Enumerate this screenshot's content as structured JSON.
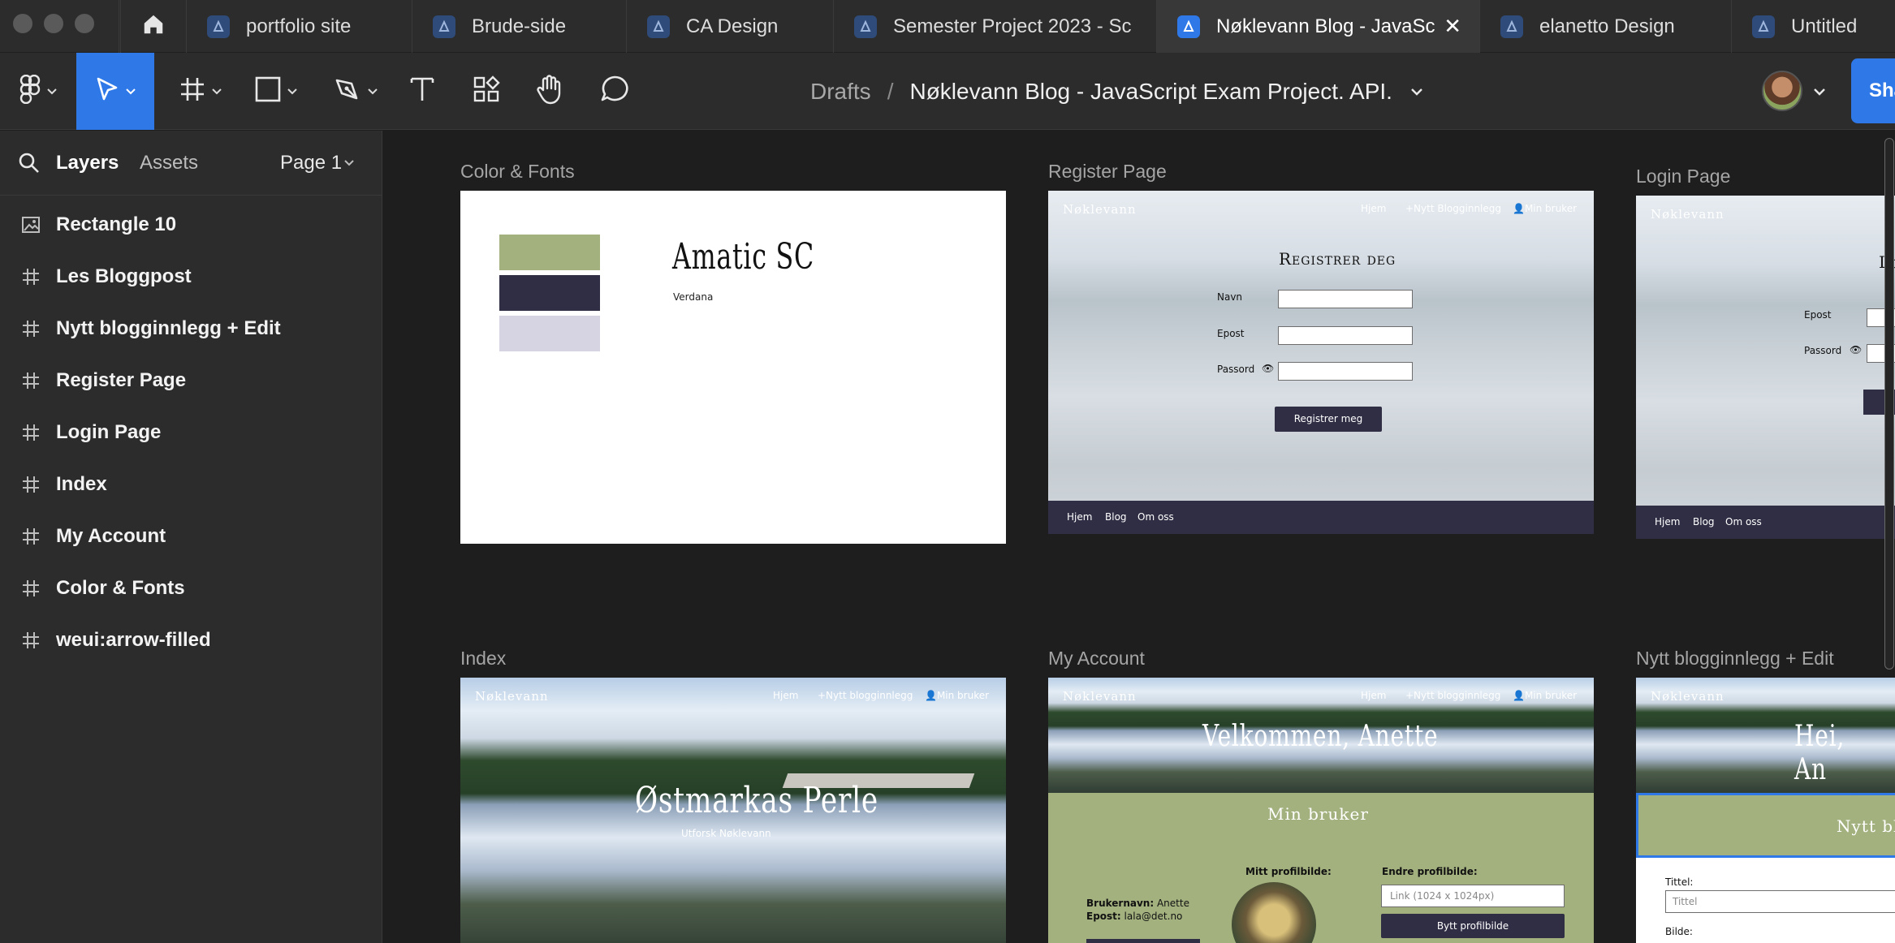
{
  "tabs": [
    {
      "title": "portfolio site",
      "active": false
    },
    {
      "title": "Brude-side",
      "active": false
    },
    {
      "title": "CA Design",
      "active": false
    },
    {
      "title": "Semester Project 2023 - Sc",
      "active": false
    },
    {
      "title": "Nøklevann Blog - JavaSc",
      "active": true
    },
    {
      "title": "elanetto Design",
      "active": false
    },
    {
      "title": "Untitled",
      "active": false
    }
  ],
  "toolbar": {
    "breadcrumb_root": "Drafts",
    "breadcrumb_sep": "/",
    "file_name": "Nøklevann Blog - JavaScript Exam Project. API.",
    "share_label": "Sha"
  },
  "left_panel": {
    "layers_tab": "Layers",
    "assets_tab": "Assets",
    "page_selector": "Page 1",
    "layers": [
      {
        "label": "Rectangle 10",
        "icon": "image-icon"
      },
      {
        "label": "Les Bloggpost",
        "icon": "frame-icon"
      },
      {
        "label": "Nytt blogginnlegg + Edit",
        "icon": "frame-icon"
      },
      {
        "label": "Register Page",
        "icon": "frame-icon"
      },
      {
        "label": "Login Page",
        "icon": "frame-icon"
      },
      {
        "label": "Index",
        "icon": "frame-icon"
      },
      {
        "label": "My Account",
        "icon": "frame-icon"
      },
      {
        "label": "Color & Fonts",
        "icon": "frame-icon"
      },
      {
        "label": "weui:arrow-filled",
        "icon": "frame-icon"
      }
    ]
  },
  "frames": {
    "color_fonts": {
      "label": "Color & Fonts",
      "font_heading": "Amatic SC",
      "font_body": "Verdana",
      "swatches": [
        "#a3b17f",
        "#302e44",
        "#d6d4e2"
      ]
    },
    "register": {
      "label": "Register Page",
      "logo": "Nøklevann",
      "nav_home": "Hjem",
      "nav_new": "+Nytt Blogginnlegg",
      "nav_account": "Min bruker",
      "heading": "Registrer deg",
      "field_name": "Navn",
      "field_email": "Epost",
      "field_password": "Passord",
      "submit": "Registrer meg",
      "footer_home": "Hjem",
      "footer_blog": "Blog",
      "footer_about": "Om oss"
    },
    "login": {
      "label": "Login Page",
      "logo": "Nøklevann",
      "heading": "Lo",
      "field_email": "Epost",
      "field_password": "Passord",
      "footer_home": "Hjem",
      "footer_blog": "Blog",
      "footer_about": "Om oss"
    },
    "index": {
      "label": "Index",
      "logo": "Nøklevann",
      "nav_home": "Hjem",
      "nav_new": "+Nytt blogginnlegg",
      "nav_account": "Min bruker",
      "hero_title": "Østmarkas Perle",
      "hero_subtitle": "Utforsk Nøklevann"
    },
    "my_account": {
      "label": "My Account",
      "logo": "Nøklevann",
      "nav_home": "Hjem",
      "nav_new": "+Nytt blogginnlegg",
      "nav_account": "Min bruker",
      "welcome": "Velkommen, Anette",
      "section_title": "Min bruker",
      "profile_pic_label": "Mitt profilbilde:",
      "change_pic_label": "Endre profilbilde:",
      "link_placeholder": "Link (1024 x 1024px)",
      "change_pic_button": "Bytt profilbilde",
      "username_label": "Brukernavn:",
      "username_value": "Anette",
      "email_label": "Epost:",
      "email_value": "lala@det.no"
    },
    "new_post": {
      "label": "Nytt blogginnlegg + Edit",
      "logo": "Nøklevann",
      "greeting": "Hei, An",
      "section_title": "Nytt blogg",
      "title_label": "Tittel:",
      "title_placeholder": "Tittel",
      "image_label": "Bilde:"
    }
  },
  "colors": {
    "accent": "#2f78e8",
    "sage": "#a3b17f",
    "navy": "#302e44",
    "lavender": "#d6d4e2"
  }
}
